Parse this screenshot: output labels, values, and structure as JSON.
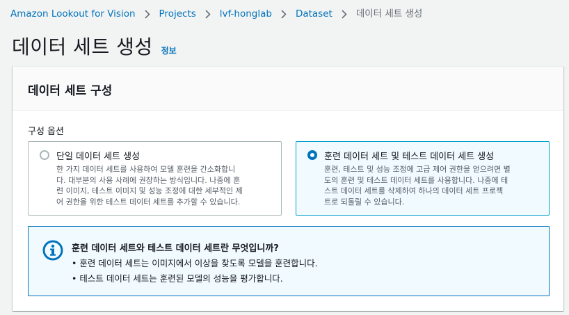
{
  "breadcrumb": {
    "items": [
      {
        "label": "Amazon Lookout for Vision"
      },
      {
        "label": "Projects"
      },
      {
        "label": "lvf-honglab"
      },
      {
        "label": "Dataset"
      }
    ],
    "current": "데이터 세트 생성"
  },
  "page": {
    "title": "데이터 세트 생성",
    "info_link": "정보"
  },
  "panel": {
    "title": "데이터 세트 구성",
    "options_label": "구성 옵션",
    "options": [
      {
        "title": "단일 데이터 세트 생성",
        "description": "한 가지 데이터 세트를 사용하여 모델 훈련을 간소화합니\n다. 대부분의 사용 사례에 권장하는 방식입니다. 나중에 훈\n련 이미지, 테스트 이미지 및 성능 조정에 대한 세부적인 제\n어 권한을 위한 테스트 데이터 세트를 추가할 수 있습니다.",
        "selected": false
      },
      {
        "title": "훈련 데이터 세트 및 테스트 데이터 세트 생성",
        "description": "훈련, 테스트 및 성능 조정에 고급 제어 권한을 얻으려면 별\n도의 훈련 및 테스트 데이터 세트를 사용합니다. 나중에 테\n스트 데이터 세트를 삭제하여 하나의 데이터 세트 프로젝\n트로 되돌릴 수 있습니다.",
        "selected": true
      }
    ]
  },
  "alert": {
    "icon": "info-icon",
    "title": "훈련 데이터 세트와 테스트 데이터 세트란 무엇입니까?",
    "items": [
      "훈련 데이터 세트는 이미지에서 이상을 찾도록 모델을 훈련합니다.",
      "테스트 데이터 세트는 훈련된 모델의 성능을 평가합니다."
    ]
  },
  "colors": {
    "link": "#0073bb",
    "selected_border": "#00a1c9",
    "selected_bg": "#f1faff",
    "text": "#16191f",
    "muted": "#545b64"
  }
}
